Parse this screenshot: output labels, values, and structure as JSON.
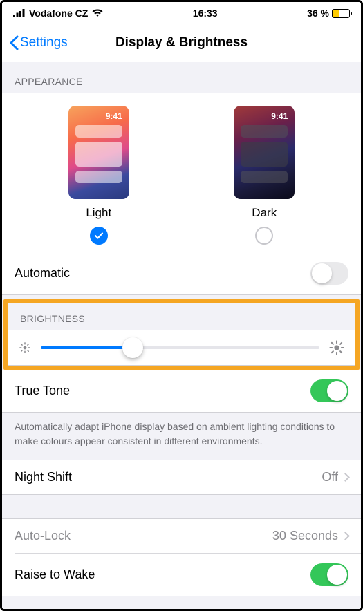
{
  "status": {
    "carrier": "Vodafone CZ",
    "time": "16:33",
    "battery_pct_text": "36 %",
    "battery_pct": 36
  },
  "nav": {
    "back_label": "Settings",
    "title": "Display & Brightness"
  },
  "appearance": {
    "header": "APPEARANCE",
    "preview_time": "9:41",
    "light_label": "Light",
    "dark_label": "Dark",
    "selected": "light",
    "automatic_label": "Automatic",
    "automatic_on": false
  },
  "brightness": {
    "header": "BRIGHTNESS",
    "value_pct": 33,
    "true_tone_label": "True Tone",
    "true_tone_on": true,
    "footer": "Automatically adapt iPhone display based on ambient lighting conditions to make colours appear consistent in different environments."
  },
  "night_shift": {
    "label": "Night Shift",
    "value": "Off"
  },
  "auto_lock": {
    "label": "Auto-Lock",
    "value": "30 Seconds"
  },
  "raise_to_wake": {
    "label": "Raise to Wake",
    "on": true
  }
}
